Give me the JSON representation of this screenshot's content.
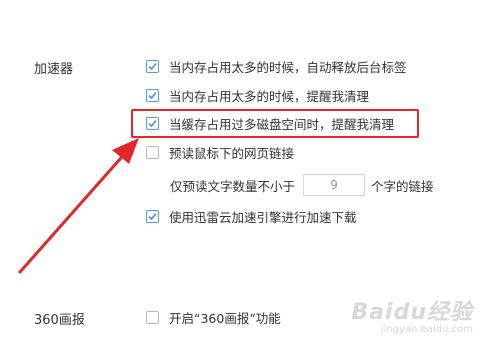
{
  "sections": {
    "accelerator_label": "加速器",
    "news_label": "360画报"
  },
  "options": [
    {
      "label": "当内存占用太多的时候，自动释放后台标签",
      "checked": true
    },
    {
      "label": "当内存占用太多的时候，提醒我清理",
      "checked": true
    },
    {
      "label": "当缓存占用过多磁盘空间时，提醒我清理",
      "checked": true
    },
    {
      "label": "预读鼠标下的网页链接",
      "checked": false
    },
    {
      "label": "使用迅雷云加速引擎进行加速下载",
      "checked": true
    },
    {
      "label": "开启“360画报”功能",
      "checked": false
    }
  ],
  "preread": {
    "prefix": "仅预读文字数量不小于",
    "value": "9",
    "suffix": "个字的链接"
  },
  "watermark": {
    "main": "Baidu经验",
    "sub": "jingyan.baidu.com"
  },
  "colors": {
    "annotation_red": "#e3262a",
    "checkbox_blue": "#4a8fd6"
  }
}
